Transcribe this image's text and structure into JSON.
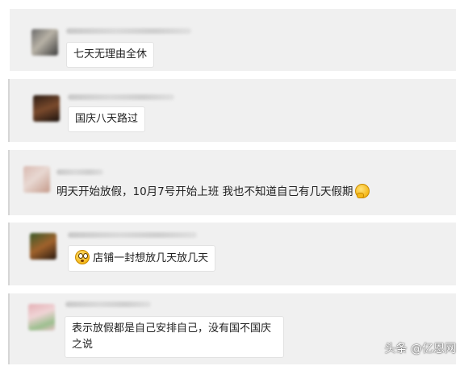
{
  "comments": [
    {
      "text": "七天无理由全休"
    },
    {
      "text": "国庆八天路过"
    },
    {
      "text": "明天开始放假，10月7号开始上班 我也不知道自己有几天假期",
      "emoji": "thinking-face-icon"
    },
    {
      "text": "店铺一封想放几天放几天",
      "emoji": "flushed-face-icon"
    },
    {
      "text": "表示放假都是自己安排自己，没有国不国庆之说"
    }
  ],
  "watermark": {
    "text": "头条 @亿恩网"
  },
  "colors": {
    "card_bg": "#f0f0f0",
    "bubble_bg": "#ffffff",
    "text": "#222222"
  }
}
